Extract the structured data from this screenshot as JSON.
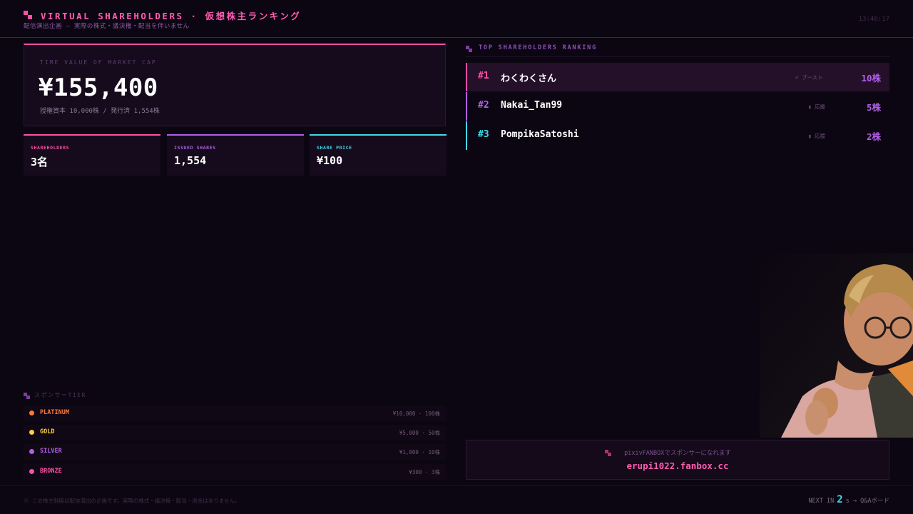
{
  "header": {
    "title": "VIRTUAL SHAREHOLDERS · 仮想株主ランキング",
    "subtitle": "配信演出企画 — 実際の株式・議決権・配当を伴いません",
    "clock": "13:46:17"
  },
  "market_cap": {
    "label": "TIME VALUE OF MARKET CAP",
    "value": "¥155,400",
    "footnote": "授権資本 10,000株 / 発行済 1,554株"
  },
  "stats": [
    {
      "label": "SHAREHOLDERS",
      "value": "3名",
      "color": "#ff4fa8"
    },
    {
      "label": "ISSUED SHARES",
      "value": "1,554",
      "color": "#b060e6"
    },
    {
      "label": "SHARE PRICE",
      "value": "¥100",
      "color": "#43d8e6"
    }
  ],
  "ranking": {
    "heading": "TOP SHAREHOLDERS RANKING",
    "rows": [
      {
        "rank": "#1",
        "name": "わくわくさん",
        "tag": "✐ ブースト",
        "shares": "10株",
        "accent": "#ff4fa8"
      },
      {
        "rank": "#2",
        "name": "Nakai_Tan99",
        "tag": "▮ 応援",
        "shares": "5株",
        "accent": "#b060e6"
      },
      {
        "rank": "#3",
        "name": "PompikaSatoshi",
        "tag": "▮ 応援",
        "shares": "2株",
        "accent": "#43d8e6"
      }
    ]
  },
  "tiers": {
    "heading": "スポンサーTIER",
    "rows": [
      {
        "name": "PLATINUM",
        "price": "¥10,000 · 100株",
        "color": "#ff7a3a"
      },
      {
        "name": "GOLD",
        "price": "¥5,000 · 50株",
        "color": "#ffd23f"
      },
      {
        "name": "SILVER",
        "price": "¥1,000 · 10株",
        "color": "#b060e6"
      },
      {
        "name": "BRONZE",
        "price": "¥300 · 3株",
        "color": "#ff4fa8"
      }
    ]
  },
  "fanbox": {
    "line1": "pixivFANBOXでスポンサーになれます",
    "url": "erupi1022.fanbox.cc"
  },
  "footer": {
    "note": "※ この株主制度は配信演出の企画です。実際の株式・議決権・配当・返金はありません。",
    "next_label": "NEXT IN",
    "next_value": "2",
    "next_suffix": "s → Q&Aボード"
  }
}
